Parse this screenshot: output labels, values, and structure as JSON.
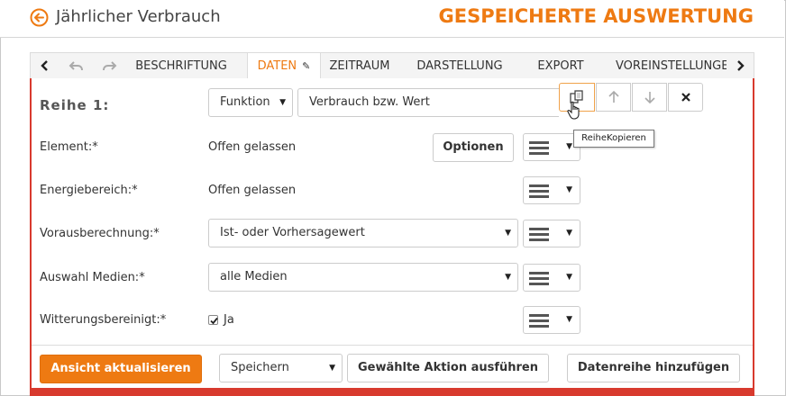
{
  "header": {
    "back_icon": "arrow-left-circle-icon",
    "title": "Jährlicher Verbrauch",
    "section_title": "GESPEICHERTE AUSWERTUNG",
    "accent_color": "#ee7a12"
  },
  "tabbar": {
    "icons": [
      "chevron-left-icon",
      "undo-icon",
      "redo-icon",
      "chevron-right-icon"
    ],
    "tabs": [
      {
        "label": "BESCHRIFTUNG",
        "active": false
      },
      {
        "label": "DATEN",
        "active": true
      },
      {
        "label": "ZEITRAUM",
        "active": false
      },
      {
        "label": "DARSTELLUNG",
        "active": false
      },
      {
        "label": "EXPORT",
        "active": false
      },
      {
        "label": "VOREINSTELLUNGEN",
        "active": false
      }
    ],
    "active_pencil_icon": "pencil-icon"
  },
  "series": {
    "label": "Reihe 1:",
    "type_select": "Funktion",
    "value_select": "Verbrauch bzw. Wert",
    "actions": [
      "copy-icon",
      "arrow-up-icon",
      "arrow-down-icon",
      "close-icon"
    ],
    "tooltip": "ReiheKopieren"
  },
  "fields": {
    "element": {
      "label": "Element:",
      "required": "*",
      "value": "Offen gelassen",
      "options_button": "Optionen"
    },
    "energiebereich": {
      "label": "Energiebereich:",
      "required": "*",
      "value": "Offen gelassen"
    },
    "vorausberechnung": {
      "label": "Vorausberechnung:",
      "required": "*",
      "value": "Ist- oder Vorhersagewert"
    },
    "medien": {
      "label": "Auswahl Medien:",
      "required": "*",
      "value": "alle Medien"
    },
    "witterung": {
      "label": "Witterungsbereinigt:",
      "required": "*",
      "checkbox_label": "Ja",
      "checked": true
    }
  },
  "footer": {
    "update_button": "Ansicht aktualisieren",
    "action_select": "Speichern",
    "execute_button": "Gewählte Aktion ausführen",
    "add_series_button": "Datenreihe hinzufügen"
  }
}
